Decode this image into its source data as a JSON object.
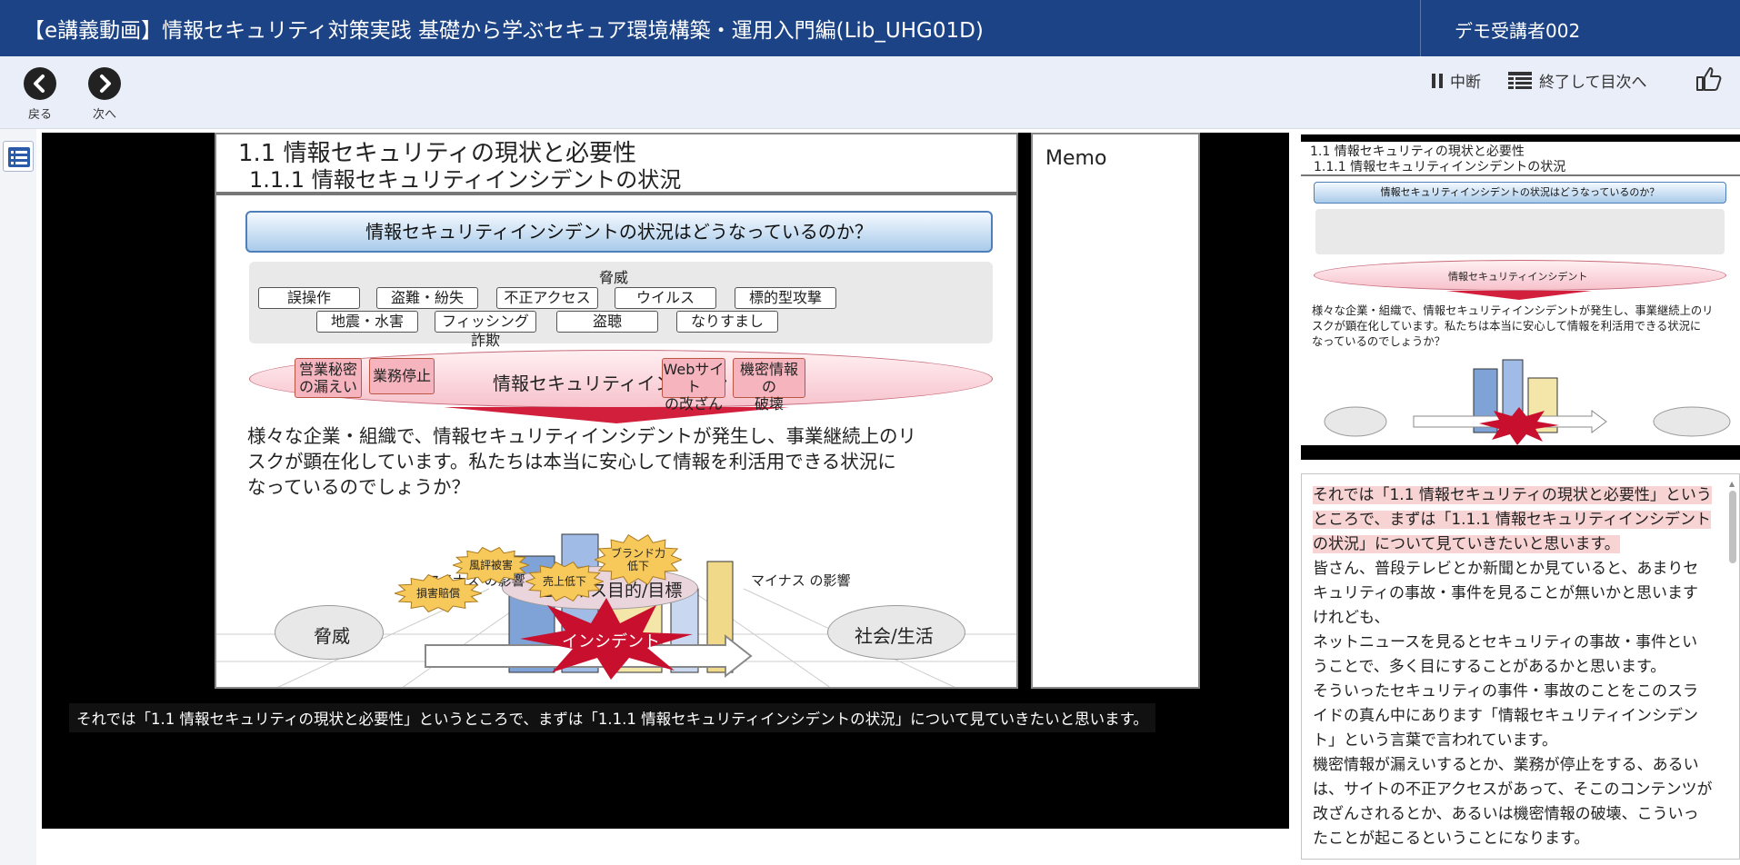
{
  "header": {
    "title": "【e講義動画】情報セキュリティ対策実践 基礎から学ぶセキュア環境構築・運用入門編(Lib_UHG01D)",
    "user": "デモ受講者002"
  },
  "toolbar": {
    "back_label": "戻る",
    "next_label": "次へ",
    "pause_label": "中断",
    "finish_label": "終了して目次へ"
  },
  "slide": {
    "heading1": "1.1 情報セキュリティの現状と必要性",
    "heading2": "1.1.1 情報セキュリティインシデントの状況",
    "question": "情報セキュリティインシデントの状況はどうなっているのか？",
    "threats_title": "脅威",
    "threats_row1": [
      "誤操作",
      "盗難・紛失",
      "不正アクセス",
      "ウイルス",
      "標的型攻撃"
    ],
    "threats_row2": [
      "地震・水害",
      "フィッシング詐欺",
      "盗聴",
      "なりすまし"
    ],
    "incident_items": [
      "営業秘密\nの漏えい",
      "業務停止",
      "Webサイト\nの改ざん",
      "機密情報の\n破壊"
    ],
    "incident_label": "情報セキュリティインシデント",
    "body_line1": "様々な企業・組織で、情報セキュリティインシデントが発生し、事業継続上のリ",
    "body_line2": "スクが顕在化しています。私たちは本当に安心して情報を利活用できる状況に",
    "body_line3": "なっているのでしょうか？",
    "bursts": [
      "風評被害",
      "売上低下",
      "ブランド力\n低下",
      "損害賠償"
    ],
    "minus_effect": "マイナス\nの影響",
    "threat_circle": "脅威",
    "business": "ビジネス目的/目標",
    "incident_burst": "インシデント",
    "society": "社会/生活"
  },
  "memo_label": "Memo",
  "caption": "それでは「1.1 情報セキュリティの現状と必要性」というところで、まずは「1.1.1 情報セキュリティインシデントの状況」について見ていきたいと思います。",
  "thumbnail": {
    "heading1": "1.1 情報セキュリティの現状と必要性",
    "heading2": "1.1.1 情報セキュリティインシデントの状況"
  },
  "transcript": {
    "highlight": "それでは「1.1 情報セキュリティの現状と必要性」というところで、まずは「1.1.1 情報セキュリティインシデントの状況」について見ていきたいと思います。",
    "p1": "皆さん、普段テレビとか新聞とか見ていると、あまりセキュリティの事故・事件を見ることが無いかと思いますけれども、",
    "p2": "ネットニュースを見るとセキュリティの事故・事件ということで、多く目にすることがあるかと思います。",
    "p3": "そういったセキュリティの事件・事故のことをこのスライドの真ん中にあります「情報セキュリティインシデント」という言葉で言われています。",
    "p4": "機密情報が漏えいするとか、業務が停止をする、あるいは、サイトの不正アクセスがあって、そこのコンテンツが改ざんされるとか、あるいは機密情報の破壊、こういったことが起こるということになります。"
  }
}
